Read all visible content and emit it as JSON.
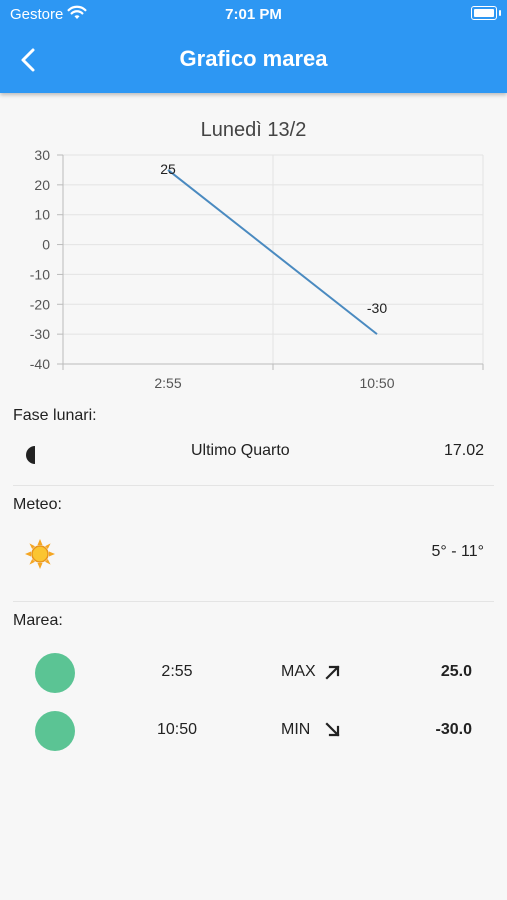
{
  "status_bar": {
    "carrier": "Gestore",
    "time": "7:01 PM"
  },
  "header": {
    "title": "Grafico marea"
  },
  "chart_title": "Lunedì 13/2",
  "chart_data": {
    "type": "line",
    "x": [
      "2:55",
      "10:50"
    ],
    "series": [
      {
        "values": [
          25,
          -30
        ]
      }
    ],
    "data_labels": [
      "25",
      "-30"
    ],
    "yticks": [
      30,
      20,
      10,
      0,
      -10,
      -20,
      -30,
      -40
    ],
    "ylim": [
      -40,
      30
    ],
    "grid": true,
    "line_color": "#4a8ac0"
  },
  "moon": {
    "label": "Fase lunari:",
    "phase": "Ultimo Quarto",
    "value": "17.02"
  },
  "meteo": {
    "label": "Meteo:",
    "temperature": "5° - 11°"
  },
  "tide": {
    "label": "Marea:",
    "rows": [
      {
        "time": "2:55",
        "type": "MAX",
        "arrow": "arrow-up-right-icon",
        "value": "25.0"
      },
      {
        "time": "10:50",
        "type": "MIN",
        "arrow": "arrow-down-right-icon",
        "value": "-30.0"
      }
    ]
  },
  "colors": {
    "header": "#2d97f3",
    "tide_dot": "#5bc494",
    "background": "#f7f7f7"
  }
}
